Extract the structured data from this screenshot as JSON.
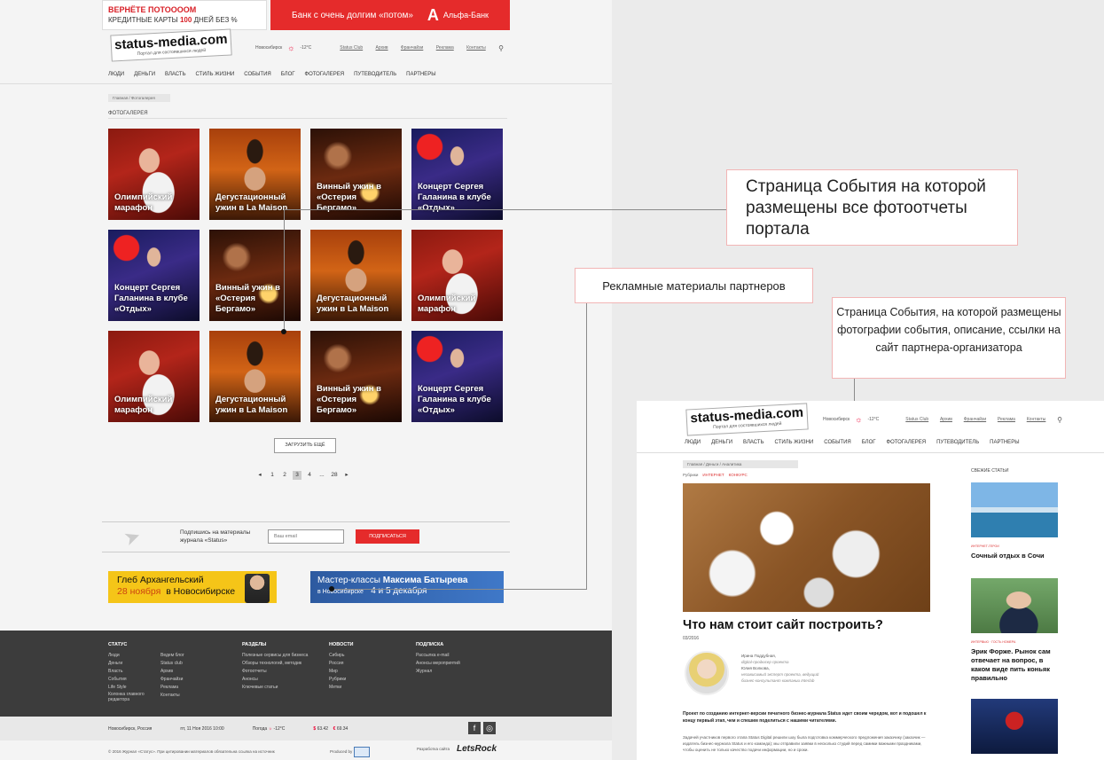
{
  "main_page": {
    "ad_banner_left": {
      "line1": "ВЕРНЁТЕ ПОТООООМ",
      "line2_a": "КРЕДИТНЫЕ КАРТЫ",
      "line2_num": "100",
      "line2_b": "ДНЕЙ БЕЗ %"
    },
    "ad_banner_right": {
      "text": "Банк с очень долгим «потом»",
      "brand_letter": "А",
      "brand": "Альфа-Банк"
    },
    "logo": {
      "name": "status",
      "domain": "-media.com",
      "tagline": "Портал для состоявшихся людей"
    },
    "topbar": {
      "city": "Новосибирск",
      "weather": "-12°C",
      "links": [
        "Status Club",
        "Архив",
        "Франчайзи",
        "Реклама",
        "Контакты"
      ]
    },
    "nav": [
      "ЛЮДИ",
      "ДЕНЬГИ",
      "ВЛАСТЬ",
      "СТИЛЬ ЖИЗНИ",
      "СОБЫТИЯ",
      "БЛОГ",
      "ФОТОГАЛЕРЕЯ",
      "ПУТЕВОДИТЕЛЬ",
      "ПАРТНЕРЫ"
    ],
    "breadcrumb": "Главная / Фотогалерея",
    "section_title": "ФОТОГАЛЕРЕЯ",
    "gallery": [
      {
        "title": "Олимпийский марафон",
        "theme": "oly"
      },
      {
        "title": "Дегустационный ужин в La Maison",
        "theme": "deg"
      },
      {
        "title": "Винный ужин в «Остерия Бергамо»",
        "theme": "vin"
      },
      {
        "title": "Концерт Сергея Галанина в клубе «Отдых»",
        "theme": "usi"
      },
      {
        "title": "Концерт Сергея Галанина в клубе «Отдых»",
        "theme": "usi"
      },
      {
        "title": "Винный ужин в «Остерия Бергамо»",
        "theme": "vin"
      },
      {
        "title": "Дегустационный ужин в La Maison",
        "theme": "deg"
      },
      {
        "title": "Олимпийский марафон",
        "theme": "oly"
      },
      {
        "title": "Олимпийский марафон",
        "theme": "oly"
      },
      {
        "title": "Дегустационный ужин в La Maison",
        "theme": "deg"
      },
      {
        "title": "Винный ужин в «Остерия Бергамо»",
        "theme": "vin"
      },
      {
        "title": "Концерт Сергея Галанина в клубе «Отдых»",
        "theme": "usi"
      }
    ],
    "load_more": "ЗАГРУЗИТЬ ЕЩЁ",
    "pagination": {
      "prev": "◂",
      "pages": [
        "1",
        "2",
        "3",
        "4",
        "...",
        "28"
      ],
      "current": "3",
      "next": "▸"
    },
    "subscribe": {
      "text": "Подпишись на материалы журнала «Status»",
      "placeholder": "Ваш email",
      "button": "ПОДПИСАТЬСЯ"
    },
    "partner_ad_1": {
      "name": "Глеб Архангельский",
      "date": "28 ноября",
      "city": "в Новосибирске"
    },
    "partner_ad_2": {
      "line1": "Мастер-классы",
      "name": "Максима Батырева",
      "city": "в Новосибирске",
      "dates": "4 и 5 декабря"
    },
    "footer": {
      "columns": [
        {
          "title": "СТАТУС",
          "items": [
            "Люди",
            "Деньги",
            "Власть",
            "События",
            "Life Style",
            "Колонка главного редактора"
          ]
        },
        {
          "title": "",
          "items": [
            "Ведем блог",
            "Status club",
            "Архив",
            "Франчайзи",
            "Реклама",
            "Контакты"
          ]
        },
        {
          "title": "РАЗДЕЛЫ",
          "items": [
            "Полезные сервисы для бизнеса",
            "Обзоры технологий, методик",
            "Фотоотчеты",
            "Анонсы",
            "Ключевые статьи"
          ]
        },
        {
          "title": "НОВОСТИ",
          "items": [
            "Сибирь",
            "Россия",
            "Мир",
            "Рубрики",
            "Метки"
          ]
        },
        {
          "title": "ПОДПИСКА",
          "items": [
            "Рассылка e-mail",
            "Анонсы мероприятий",
            "Журнал"
          ]
        }
      ],
      "location": "Новосибирск, Россия",
      "datetime": "пт, 11 Ноя 2016 10:00",
      "weather_label": "Погода",
      "weather_value": "-12°C",
      "usd_symbol": "$",
      "usd": "63.42",
      "eur_symbol": "€",
      "eur": "69.34",
      "copyright": "© 2016 Журнал «Статус». При цитировании материалов обязательна ссылка на источник",
      "produced_by": "Produced by",
      "developer_label": "Разработка сайта",
      "developer": "LetsRock"
    }
  },
  "annotations": {
    "events_page": "Страница События на которой размещены все фотоотчеты портала",
    "partner_materials": "Рекламные материалы партнеров",
    "event_detail": "Страница События, на которой размещены фотографии события, описание, ссылки на сайт партнера-организатора"
  },
  "article_page": {
    "breadcrumb": "Главная / Деньги / Аналитика",
    "rubrics_label": "Рубрики",
    "rubrics": [
      "ИНТЕРНЕТ",
      "КОНКУРС"
    ],
    "title": "Что нам стоит сайт построить?",
    "date": "03/2016",
    "author1": {
      "name": "Ирина Поддубная,",
      "role": "digital-продюсер проекта"
    },
    "author2": {
      "name": "Юлия Волкова,",
      "role": "независимый эксперт проекта, ведущий бизнес-консультант компании Interlab"
    },
    "lead": "Проект по созданию интернет-версии печатного бизнес-журнала Status идет своим чередом, вот и подошел к концу первый этап, чем и спешим поделиться с нашими читателями.",
    "body": "Задачей участников первого этапа Status Digital решили шоу была подготовка коммерческого предложения заказчику (заказчик — издатель бизнес-журнала Status и его команда); мы отправили заявки в несколько студий перед самими важными праздниками, чтобы оценить не только качество подачи информации, но и сроки.",
    "sidebar_title": "СВЕЖИЕ СТАТЬИ",
    "sidebar": [
      {
        "tag": "ИНТЕРНЕТ-ГЕРОИ",
        "title": "Сочный отдых в Сочи"
      },
      {
        "tag": "ИНТЕРВЬЮ · ГОСТЬ НОМЕРА",
        "title": "Эрик Форже. Рынок сам отвечает на вопрос, в каком виде пить коньяк правильно"
      },
      {
        "tag": "",
        "title": ""
      }
    ]
  },
  "colors": {
    "brand_red": "#e52b2b",
    "accent_red": "#d81f26",
    "footer_dark": "#3c3c3c",
    "annotation_border": "#f2b5b5"
  }
}
